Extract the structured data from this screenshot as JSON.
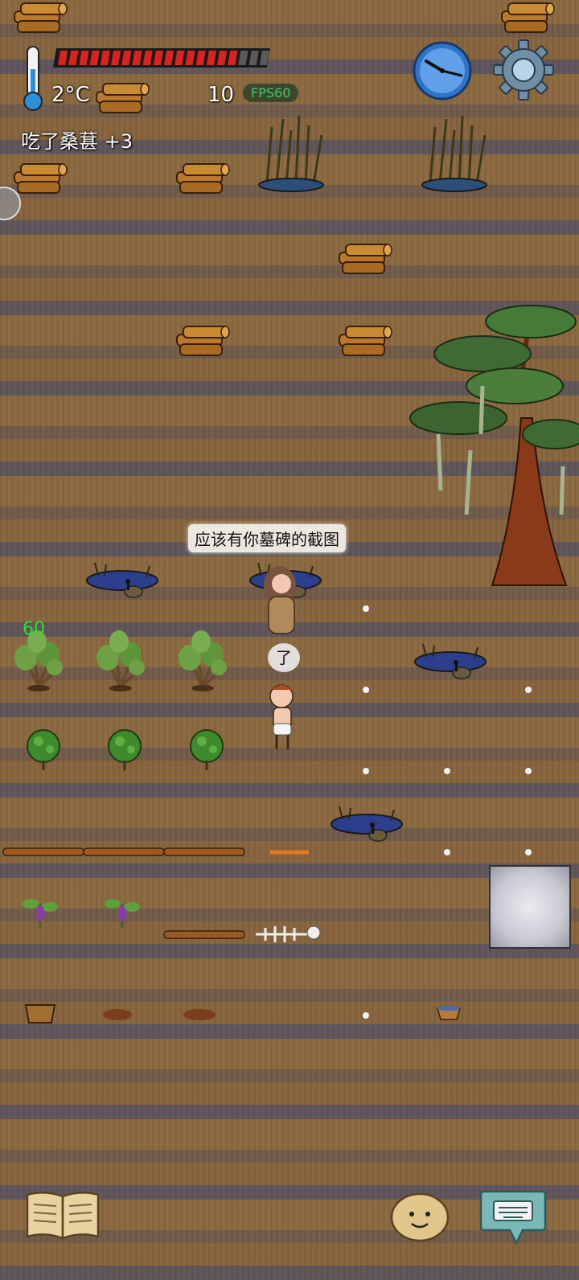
{
  "hud": {
    "temperature": "2°C",
    "food_count": "10",
    "fps": "FPS60",
    "last_action": "吃了桑葚 +3",
    "health_segments_total": 20,
    "health_segments_filled": 17
  },
  "speech": {
    "other_player": "应该有你墓碑的截图",
    "player": "了"
  },
  "floating_number": "60",
  "icons": {
    "thermometer": "thermometer-icon",
    "clock": "clock-icon",
    "settings": "gear-icon",
    "book": "book-icon",
    "emote": "potato-face-icon",
    "chat": "keyboard-chat-icon"
  },
  "colors": {
    "health_fill": "#d8241c",
    "health_empty": "#5a5a5a",
    "fps_text": "#3fcc5f",
    "floating_number": "#2ee02e"
  }
}
